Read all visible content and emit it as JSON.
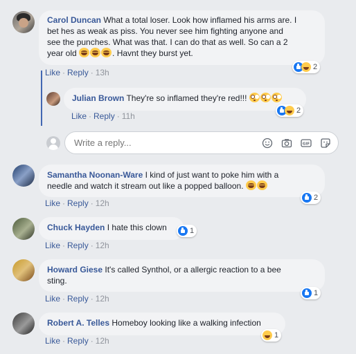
{
  "comments": [
    {
      "author": "Carol Duncan",
      "text_part1": "What a total loser. Look how inflamed his arms are. I",
      "text_part2": "bet hes as weak as piss. You never see him fighting anyone and",
      "text_part3": "see the punches. What was that. I can do that as well. So can a 2",
      "text_part4_pre": "year old",
      "text_part4_post": ". Havnt they burst yet.",
      "like": "Like",
      "reply": "Reply",
      "time": "13h",
      "reactions": "2"
    },
    {
      "author": "Julian Brown",
      "text": "They're so inflamed they're red!!!",
      "like": "Like",
      "reply": "Reply",
      "time": "11h",
      "reactions": "2"
    },
    {
      "author": "Samantha Noonan-Ware",
      "text_part1": "I kind of just want to poke him with a",
      "text_part2": "needle and watch it stream out like a popped balloon.",
      "like": "Like",
      "reply": "Reply",
      "time": "12h",
      "reactions": "2"
    },
    {
      "author": "Chuck Hayden",
      "text": "I hate this clown",
      "like": "Like",
      "reply": "Reply",
      "time": "12h",
      "reactions": "1"
    },
    {
      "author": "Howard Giese",
      "text_part1": "It's called Synthol, or a allergic reaction to a bee",
      "text_part2": "sting.",
      "like": "Like",
      "reply": "Reply",
      "time": "12h",
      "reactions": "1"
    },
    {
      "author": "Robert A. Telles",
      "text": "Homeboy looking like a walking infection",
      "like": "Like",
      "reply": "Reply",
      "time": "12h",
      "reactions": "1"
    }
  ],
  "reply_box": {
    "placeholder": "Write a reply..."
  },
  "icons": {
    "emoji": "smiley-icon",
    "camera": "camera-icon",
    "gif": "gif-icon",
    "sticker": "sticker-icon"
  },
  "colors": {
    "link": "#385898",
    "like_blue": "#1877f2",
    "thread_bar": "#4267b2"
  }
}
